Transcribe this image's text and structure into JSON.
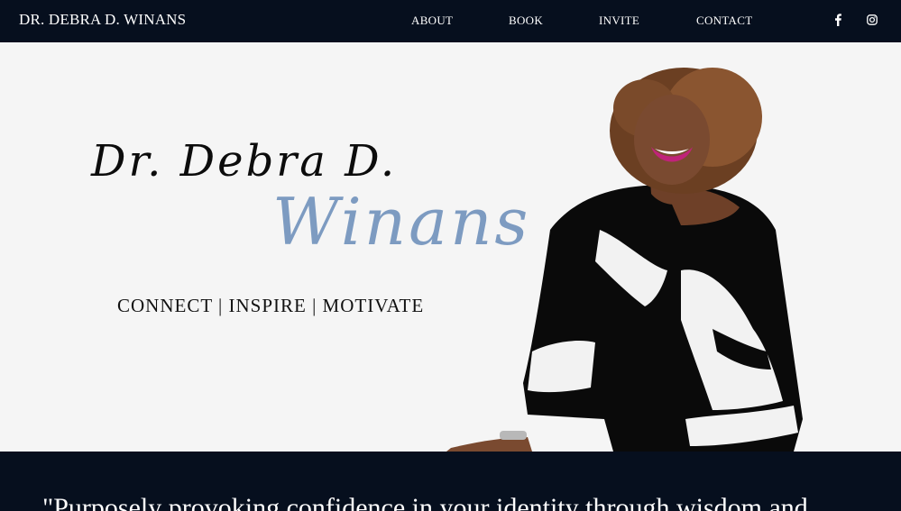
{
  "header": {
    "brand": "DR. DEBRA D. WINANS",
    "nav": [
      "ABOUT",
      "BOOK",
      "INVITE",
      "CONTACT"
    ],
    "social": [
      {
        "icon": "facebook-icon"
      },
      {
        "icon": "instagram-icon"
      }
    ]
  },
  "hero": {
    "script_line1": "Dr. Debra D.",
    "script_line2": "Winans",
    "tagline": "CONNECT | INSPIRE | MOTIVATE"
  },
  "quote": {
    "text": "\"Purposely provoking confidence in your identity through wisdom and"
  },
  "colors": {
    "nav_bg": "#060f1e",
    "hero_bg": "#f5f5f5",
    "accent_blue": "#7d9bc1",
    "text_dark": "#111111"
  }
}
